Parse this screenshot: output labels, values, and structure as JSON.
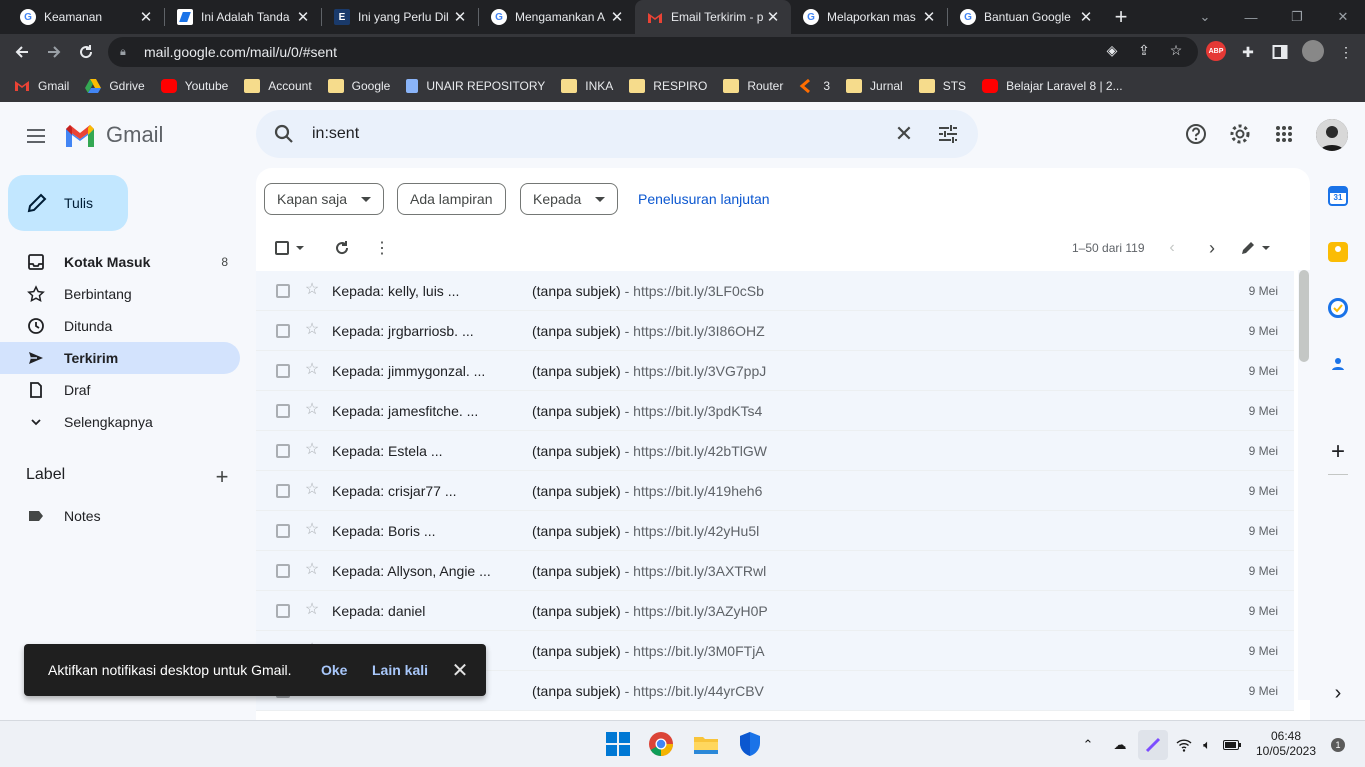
{
  "browser": {
    "tabs": [
      {
        "title": "Keamanan",
        "favicon": "google-icon",
        "color": "#ffffff",
        "active": false
      },
      {
        "title": "Ini Adalah Tanda",
        "favicon": "kompas-icon",
        "color": "#ffffff",
        "active": false
      },
      {
        "title": "Ini yang Perlu Dil",
        "favicon": "e-icon",
        "color": "#1a3a6b",
        "active": false
      },
      {
        "title": "Mengamankan A",
        "favicon": "google-icon",
        "color": "#ffffff",
        "active": false
      },
      {
        "title": "Email Terkirim - p",
        "favicon": "gmail-icon",
        "color": "#ea4335",
        "active": true
      },
      {
        "title": "Melaporkan mas",
        "favicon": "google-icon",
        "color": "#ffffff",
        "active": false
      },
      {
        "title": "Bantuan Google",
        "favicon": "google-icon",
        "color": "#ffffff",
        "active": false
      }
    ],
    "url": "mail.google.com/mail/u/0/#sent",
    "bookmarks": [
      {
        "label": "Gmail",
        "icon": "gmail-icon"
      },
      {
        "label": "Gdrive",
        "icon": "drive-icon"
      },
      {
        "label": "Youtube",
        "icon": "youtube-icon"
      },
      {
        "label": "Account",
        "icon": "folder-icon"
      },
      {
        "label": "Google",
        "icon": "folder-icon"
      },
      {
        "label": "UNAIR REPOSITORY",
        "icon": "doc-icon"
      },
      {
        "label": "INKA",
        "icon": "folder-icon"
      },
      {
        "label": "RESPIRO",
        "icon": "folder-icon"
      },
      {
        "label": "Router",
        "icon": "folder-icon"
      },
      {
        "label": "3",
        "icon": "bookmark-3-icon"
      },
      {
        "label": "Jurnal",
        "icon": "folder-icon"
      },
      {
        "label": "STS",
        "icon": "folder-icon"
      },
      {
        "label": "Belajar Laravel 8 | 2...",
        "icon": "youtube-icon"
      }
    ]
  },
  "gmail": {
    "brand": "Gmail",
    "search_query": "in:sent",
    "compose_label": "Tulis",
    "nav": [
      {
        "label": "Kotak Masuk",
        "icon": "inbox-icon",
        "count": "8",
        "bold": true,
        "active": false
      },
      {
        "label": "Berbintang",
        "icon": "star-icon",
        "count": "",
        "bold": false,
        "active": false
      },
      {
        "label": "Ditunda",
        "icon": "clock-icon",
        "count": "",
        "bold": false,
        "active": false
      },
      {
        "label": "Terkirim",
        "icon": "send-icon",
        "count": "",
        "bold": true,
        "active": true
      },
      {
        "label": "Draf",
        "icon": "draft-icon",
        "count": "",
        "bold": false,
        "active": false
      },
      {
        "label": "Selengkapnya",
        "icon": "chevron-down-icon",
        "count": "",
        "bold": false,
        "active": false
      }
    ],
    "labels_title": "Label",
    "labels": [
      {
        "label": "Notes",
        "icon": "label-icon"
      }
    ],
    "filters": {
      "time": "Kapan saja",
      "attachment": "Ada lampiran",
      "to": "Kepada",
      "advanced": "Penelusuran lanjutan"
    },
    "pagination": "1–50 dari 119",
    "emails": [
      {
        "to": "Kepada: kelly, luis ...",
        "subject": "(tanpa subjek)",
        "snippet": " - https://bit.ly/3LF0cSb",
        "date": "9 Mei"
      },
      {
        "to": "Kepada: jrgbarriosb. ...",
        "subject": "(tanpa subjek)",
        "snippet": " - https://bit.ly/3I86OHZ",
        "date": "9 Mei"
      },
      {
        "to": "Kepada: jimmygonzal. ...",
        "subject": "(tanpa subjek)",
        "snippet": " - https://bit.ly/3VG7ppJ",
        "date": "9 Mei"
      },
      {
        "to": "Kepada: jamesfitche. ...",
        "subject": "(tanpa subjek)",
        "snippet": " - https://bit.ly/3pdKTs4",
        "date": "9 Mei"
      },
      {
        "to": "Kepada: Estela ...",
        "subject": "(tanpa subjek)",
        "snippet": " - https://bit.ly/42bTlGW",
        "date": "9 Mei"
      },
      {
        "to": "Kepada: crisjar77 ...",
        "subject": "(tanpa subjek)",
        "snippet": " - https://bit.ly/419heh6",
        "date": "9 Mei"
      },
      {
        "to": "Kepada: Boris ...",
        "subject": "(tanpa subjek)",
        "snippet": " - https://bit.ly/42yHu5l",
        "date": "9 Mei"
      },
      {
        "to": "Kepada: Allyson, Angie ...",
        "subject": "(tanpa subjek)",
        "snippet": " - https://bit.ly/3AXTRwl",
        "date": "9 Mei"
      },
      {
        "to": "Kepada: daniel",
        "subject": "(tanpa subjek)",
        "snippet": " - https://bit.ly/3AZyH0P",
        "date": "9 Mei"
      },
      {
        "to": "",
        "subject": "(tanpa subjek)",
        "snippet": " - https://bit.ly/3M0FTjA",
        "date": "9 Mei"
      },
      {
        "to": "",
        "subject": "(tanpa subjek)",
        "snippet": " - https://bit.ly/44yrCBV",
        "date": "9 Mei"
      }
    ],
    "toast": {
      "message": "Aktifkan notifikasi desktop untuk Gmail.",
      "ok": "Oke",
      "later": "Lain kali"
    }
  },
  "taskbar": {
    "time": "06:48",
    "date": "10/05/2023",
    "notifications": "1"
  }
}
